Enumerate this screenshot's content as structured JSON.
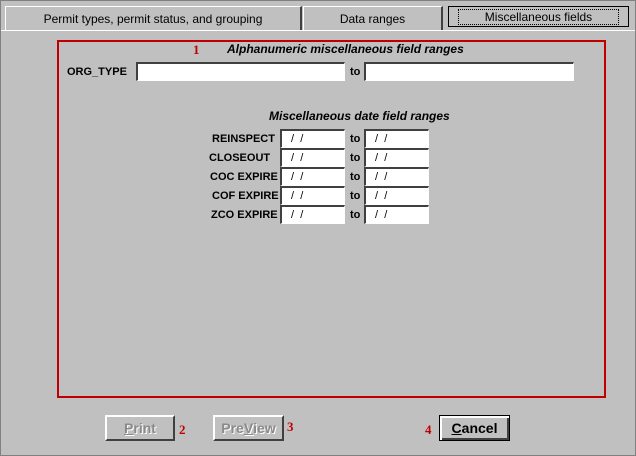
{
  "tabs": [
    {
      "label": "Permit types, permit status, and grouping",
      "active": false
    },
    {
      "label": "Data ranges",
      "active": false
    },
    {
      "label": "Miscellaneous fields",
      "active": true
    }
  ],
  "markers": {
    "m1": "1",
    "m2": "2",
    "m3": "3",
    "m4": "4"
  },
  "alpha_section": {
    "heading": "Alphanumeric miscellaneous field ranges",
    "field_label": "ORG_TYPE",
    "to_label": "to",
    "from_value": "",
    "to_value": ""
  },
  "date_section": {
    "heading": "Miscellaneous date field ranges",
    "to_label": "to",
    "rows": [
      {
        "label": "REINSPECT",
        "from": " /  /",
        "to": " /  /"
      },
      {
        "label": "CLOSEOUT",
        "from": " /  /",
        "to": " /  /"
      },
      {
        "label": "COC EXPIRE",
        "from": " /  /",
        "to": " /  /"
      },
      {
        "label": "COF EXPIRE",
        "from": " /  /",
        "to": " /  /"
      },
      {
        "label": "ZCO EXPIRE",
        "from": " /  /",
        "to": " /  /"
      }
    ]
  },
  "buttons": {
    "print": {
      "label_first": "P",
      "label_rest": "rint",
      "enabled": false
    },
    "preview": {
      "label_first": "Pre",
      "label_u": "V",
      "label_rest": "iew",
      "enabled": false
    },
    "cancel": {
      "label_first": "C",
      "label_rest": "ancel",
      "enabled": true
    }
  },
  "colors": {
    "accent_red": "#c00000",
    "panel": "#c0c0c0"
  }
}
